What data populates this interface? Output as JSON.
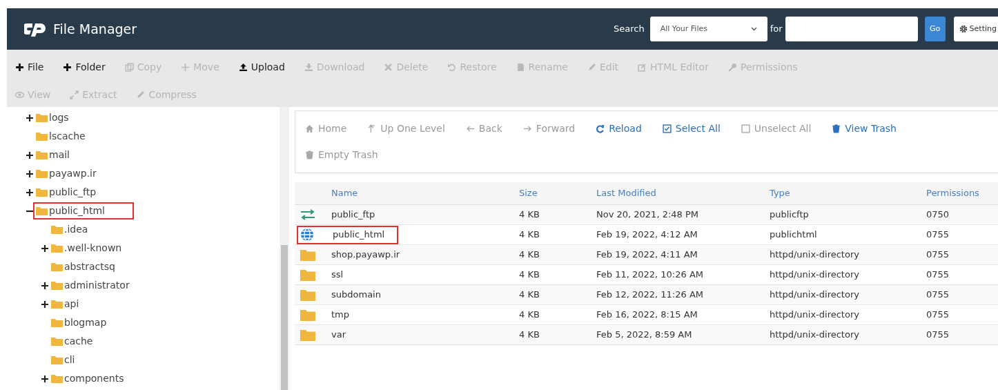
{
  "header": {
    "title": "File Manager",
    "search_label": "Search",
    "search_scope": "All Your Files",
    "for_label": "for",
    "go_button": "Go",
    "settings_button": "Setting"
  },
  "toolbar": [
    {
      "label": "File",
      "disabled": false
    },
    {
      "label": "Folder",
      "disabled": false
    },
    {
      "label": "Copy",
      "disabled": true
    },
    {
      "label": "Move",
      "disabled": true
    },
    {
      "label": "Upload",
      "disabled": false
    },
    {
      "label": "Download",
      "disabled": true
    },
    {
      "label": "Delete",
      "disabled": true
    },
    {
      "label": "Restore",
      "disabled": true
    },
    {
      "label": "Rename",
      "disabled": true
    },
    {
      "label": "Edit",
      "disabled": true
    },
    {
      "label": "HTML Editor",
      "disabled": true
    },
    {
      "label": "Permissions",
      "disabled": true
    },
    {
      "label": "View",
      "disabled": true
    },
    {
      "label": "Extract",
      "disabled": true
    },
    {
      "label": "Compress",
      "disabled": true
    }
  ],
  "tree": [
    {
      "label": "logs",
      "kind": "branch",
      "expanded": false
    },
    {
      "label": "lscache",
      "kind": "leaf"
    },
    {
      "label": "mail",
      "kind": "branch",
      "expanded": false
    },
    {
      "label": "payawp.ir",
      "kind": "branch",
      "expanded": false
    },
    {
      "label": "public_ftp",
      "kind": "branch",
      "expanded": false
    },
    {
      "label": "public_html",
      "kind": "branch",
      "expanded": true,
      "marked": true,
      "children": [
        {
          "label": ".idea",
          "kind": "leaf"
        },
        {
          "label": ".well-known",
          "kind": "branch",
          "expanded": false
        },
        {
          "label": "abstractsq",
          "kind": "leaf"
        },
        {
          "label": "administrator",
          "kind": "branch",
          "expanded": false
        },
        {
          "label": "api",
          "kind": "branch",
          "expanded": false
        },
        {
          "label": "blogmap",
          "kind": "leaf"
        },
        {
          "label": "cache",
          "kind": "leaf"
        },
        {
          "label": "cli",
          "kind": "leaf"
        },
        {
          "label": "components",
          "kind": "branch",
          "expanded": false
        }
      ]
    }
  ],
  "nav": [
    {
      "label": "Home",
      "disabled": true
    },
    {
      "label": "Up One Level",
      "disabled": true
    },
    {
      "label": "Back",
      "disabled": true
    },
    {
      "label": "Forward",
      "disabled": true
    },
    {
      "label": "Reload",
      "disabled": false
    },
    {
      "label": "Select All",
      "disabled": false
    },
    {
      "label": "Unselect All",
      "disabled": true
    },
    {
      "label": "View Trash",
      "disabled": false
    },
    {
      "label": "Empty Trash",
      "disabled": true
    }
  ],
  "table": {
    "columns": [
      "Name",
      "Size",
      "Last Modified",
      "Type",
      "Permissions"
    ],
    "rows": [
      {
        "kind": "redirect",
        "name": "public_ftp",
        "size": "4 KB",
        "modified": "Nov 20, 2021, 2:48 PM",
        "type": "publicftp",
        "permissions": "0750",
        "marked": false
      },
      {
        "kind": "web",
        "name": "public_html",
        "size": "4 KB",
        "modified": "Feb 19, 2022, 4:12 AM",
        "type": "publichtml",
        "permissions": "0755",
        "marked": true
      },
      {
        "kind": "folder",
        "name": "shop.payawp.ir",
        "size": "4 KB",
        "modified": "Feb 19, 2022, 4:11 AM",
        "type": "httpd/unix-directory",
        "permissions": "0755",
        "marked": false
      },
      {
        "kind": "folder",
        "name": "ssl",
        "size": "4 KB",
        "modified": "Feb 11, 2022, 10:26 AM",
        "type": "httpd/unix-directory",
        "permissions": "0755",
        "marked": false
      },
      {
        "kind": "folder",
        "name": "subdomain",
        "size": "4 KB",
        "modified": "Feb 12, 2022, 11:26 AM",
        "type": "httpd/unix-directory",
        "permissions": "0755",
        "marked": false
      },
      {
        "kind": "folder",
        "name": "tmp",
        "size": "4 KB",
        "modified": "Feb 16, 2022, 8:15 AM",
        "type": "httpd/unix-directory",
        "permissions": "0755",
        "marked": false
      },
      {
        "kind": "folder",
        "name": "var",
        "size": "4 KB",
        "modified": "Feb 5, 2022, 8:59 AM",
        "type": "httpd/unix-directory",
        "permissions": "0755",
        "marked": false
      }
    ]
  }
}
